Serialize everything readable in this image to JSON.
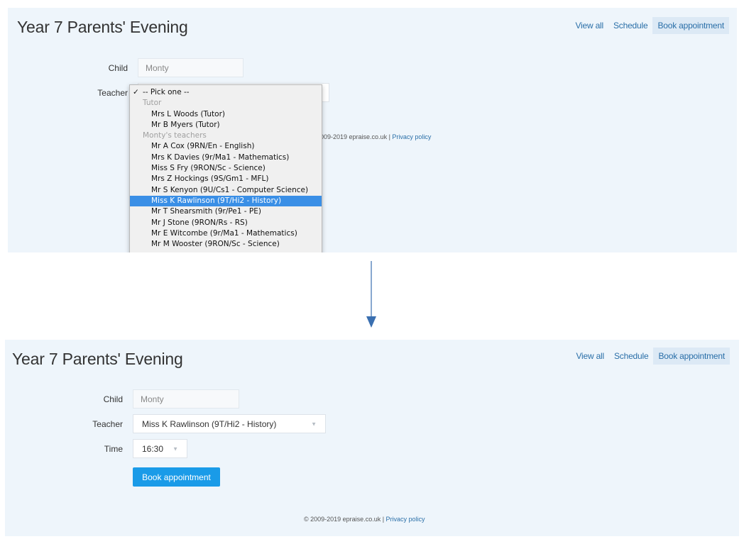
{
  "page": {
    "title": "Year 7 Parents' Evening"
  },
  "nav": {
    "items": [
      {
        "label": "View all",
        "active": false
      },
      {
        "label": "Schedule",
        "active": false
      },
      {
        "label": "Book appointment",
        "active": true
      }
    ]
  },
  "form": {
    "child_label": "Child",
    "child_value": "Monty",
    "teacher_label": "Teacher",
    "teacher_value": "Miss K Rawlinson (9T/Hi2 - History)",
    "time_label": "Time",
    "time_value": "16:30",
    "submit_label": "Book appointment"
  },
  "dropdown": {
    "placeholder": "-- Pick one --",
    "groups": [
      {
        "label": "Tutor",
        "options": [
          "Mrs L Woods (Tutor)",
          "Mr B Myers (Tutor)"
        ]
      },
      {
        "label": "Monty's teachers",
        "options": [
          "Mr A Cox (9RN/En - English)",
          "Mrs K Davies (9r/Ma1 - Mathematics)",
          "Miss S Fry (9RON/Sc - Science)",
          "Mrs Z Hockings (9S/Gm1 - MFL)",
          "Mr S Kenyon (9U/Cs1 - Computer Science)",
          "Miss K Rawlinson (9T/Hi2 - History)",
          "Mr T Shearsmith (9r/Pe1 - PE)",
          "Mr J Stone (9RON/Rs - RS)",
          "Mr E Witcombe (9r/Ma1 - Mathematics)",
          "Mr M Wooster (9RON/Sc - Science)"
        ]
      }
    ],
    "selected": "Miss K Rawlinson (9T/Hi2 - History)"
  },
  "footer": {
    "copyright": "© 2009-2019 epraise.co.uk",
    "copyright_partial": "009-2019 epraise.co.uk",
    "separator": " | ",
    "privacy_label": "Privacy policy"
  },
  "icons": {
    "check": "checkmark-icon",
    "caret": "caret-down-icon",
    "arrow": "arrow-down-icon"
  },
  "colors": {
    "accent": "#1a9be8",
    "link": "#2a6fa8",
    "panel": "#eef5fb",
    "highlight": "#3a8fe6"
  }
}
